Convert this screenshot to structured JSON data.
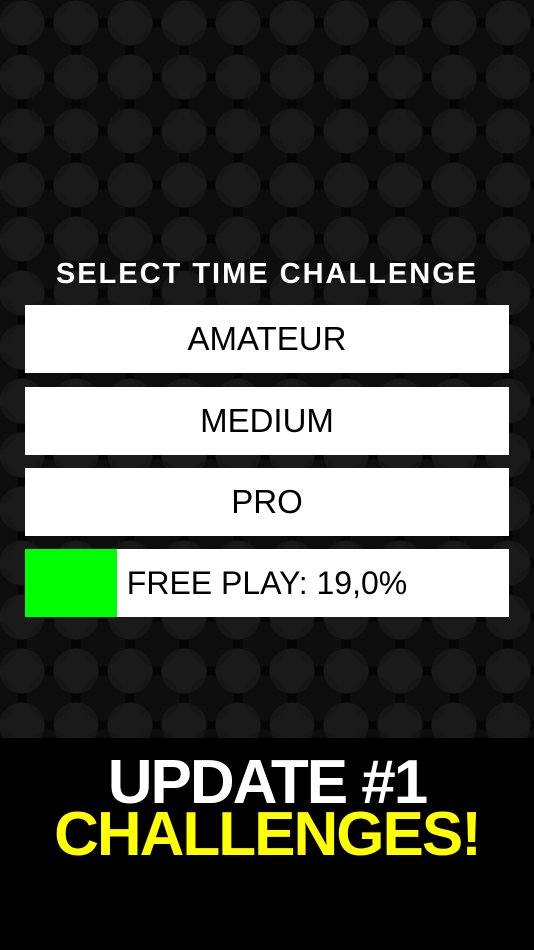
{
  "menu": {
    "heading": "SELECT TIME CHALLENGE",
    "amateur_label": "AMATEUR",
    "medium_label": "MEDIUM",
    "pro_label": "PRO",
    "free_play": {
      "label": "FREE PLAY: 19,0%",
      "progress_fraction": 0.19,
      "fill_color": "#00ff00"
    }
  },
  "banner": {
    "line1": "UPDATE #1",
    "line2": "CHALLENGES!",
    "line1_color": "#ffffff",
    "line2_color": "#ffff00"
  },
  "colors": {
    "background": "#000000",
    "button": "#ffffff",
    "button_text": "#000000"
  }
}
